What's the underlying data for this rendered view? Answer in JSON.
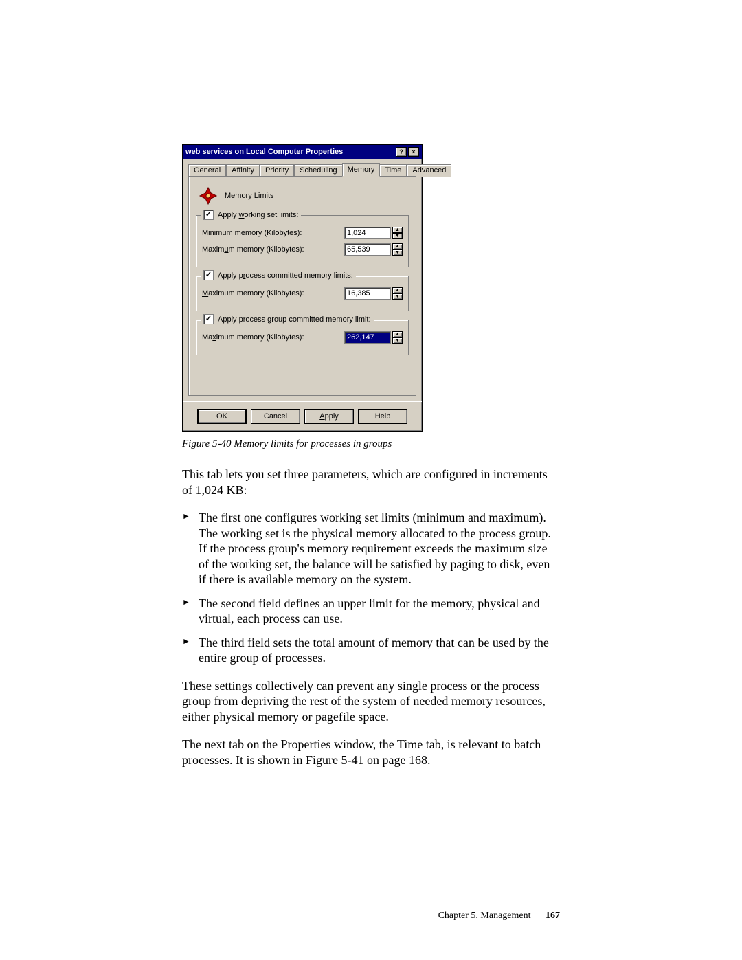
{
  "dialog": {
    "title": "web services on Local Computer Properties",
    "help_btn": "?",
    "close_btn": "×",
    "tabs": {
      "general": "General",
      "affinity": "Affinity",
      "priority": "Priority",
      "scheduling": "Scheduling",
      "memory": "Memory",
      "time": "Time",
      "advanced": "Advanced"
    },
    "heading": "Memory Limits",
    "group1": {
      "legend": "Apply working set limits:",
      "checked": "✓",
      "min_label_pre": "M",
      "min_label_u": "i",
      "min_label_post": "nimum memory (Kilobytes):",
      "min_value": "1,024",
      "max_label_pre": "Maxim",
      "max_label_u": "u",
      "max_label_post": "m memory (Kilobytes):",
      "max_value": "65,539"
    },
    "group2": {
      "legend_pre": "Apply p",
      "legend_u": "r",
      "legend_post": "ocess committed memory limits:",
      "checked": "✓",
      "max_label_pre": "",
      "max_label_u": "M",
      "max_label_post": "aximum memory (Kilobytes):",
      "max_value": "16,385"
    },
    "group3": {
      "legend_pre": "Apply process ",
      "legend_u": "g",
      "legend_post": "roup committed memory limit:",
      "checked": "✓",
      "max_label_pre": "Ma",
      "max_label_u": "x",
      "max_label_post": "imum memory (Kilobytes):",
      "max_value": "262,147"
    },
    "buttons": {
      "ok": "OK",
      "cancel": "Cancel",
      "apply_u": "A",
      "apply_rest": "pply",
      "help": "Help"
    }
  },
  "caption": "Figure 5-40   Memory limits for processes in groups",
  "para1": "This tab lets you set three parameters, which are configured in increments of 1,024 KB:",
  "bullets": [
    "The first one configures working set limits (minimum and maximum). The working set is the physical memory allocated to the process group. If the process group's memory requirement exceeds the maximum size of the working set, the balance will be satisfied by paging to disk, even if there is available memory on the system.",
    "The second field defines an upper limit for the memory, physical and virtual, each process can use.",
    "The third field sets the total amount of memory that can be used by the entire group of processes."
  ],
  "para2": "These settings collectively can prevent any single process or the process group from depriving the rest of the system of needed memory resources, either physical memory or pagefile space.",
  "para3": "The next tab on the Properties window, the Time tab, is relevant to batch processes. It is shown in Figure 5-41 on page 168.",
  "footer": {
    "chapter": "Chapter 5. Management",
    "page": "167"
  }
}
